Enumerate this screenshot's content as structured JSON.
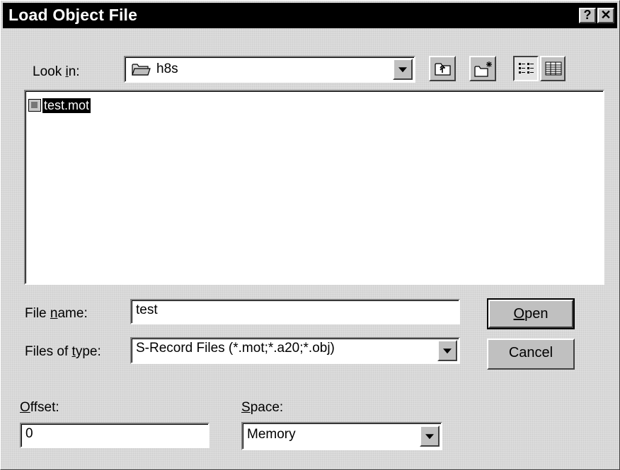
{
  "window": {
    "title": "Load Object File",
    "help_glyph": "?",
    "close_glyph": "✕"
  },
  "look_in": {
    "label_prefix": "Look ",
    "label_accel": "i",
    "label_suffix": "n:",
    "value": "h8s",
    "icon": "folder-open-icon"
  },
  "toolbar": {
    "up_folder_icon": "up-folder-icon",
    "new_folder_icon": "new-folder-icon",
    "list_view_icon": "list-view-icon",
    "details_view_icon": "details-view-icon"
  },
  "files": [
    {
      "name": "test.mot",
      "icon": "file-icon",
      "selected": true
    }
  ],
  "file_name": {
    "label_prefix": "File ",
    "label_accel": "n",
    "label_suffix": "ame:",
    "value": "test"
  },
  "file_type": {
    "label_prefix": "Files of ",
    "label_accel": "t",
    "label_suffix": "ype:",
    "value": "S-Record Files (*.mot;*.a20;*.obj)"
  },
  "buttons": {
    "open_accel": "O",
    "open_rest": "pen",
    "cancel": "Cancel"
  },
  "offset": {
    "label_accel": "O",
    "label_rest": "ffset:",
    "value": "0"
  },
  "space": {
    "label_accel": "S",
    "label_rest": "pace:",
    "value": "Memory"
  }
}
